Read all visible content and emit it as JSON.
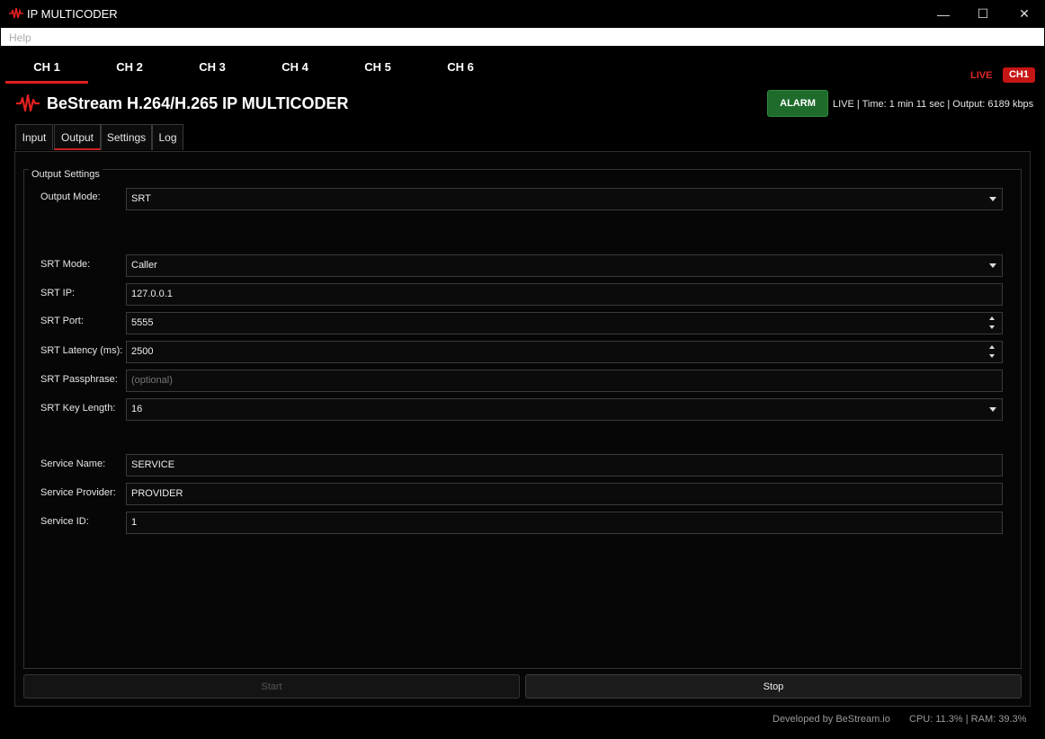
{
  "window": {
    "title": "IP MULTICODER",
    "minimize": "—",
    "maximize": "☐",
    "close": "✕"
  },
  "menu": {
    "help": "Help"
  },
  "channels": [
    "CH 1",
    "CH 2",
    "CH 3",
    "CH 4",
    "CH 5",
    "CH 6"
  ],
  "live_label": "LIVE",
  "channel_badge": "CH1",
  "header": {
    "title": "BeStream H.264/H.265 IP MULTICODER",
    "alarm": "ALARM",
    "status": "LIVE | Time: 1 min 11 sec | Output: 6189 kbps"
  },
  "tabs": [
    "Input",
    "Output",
    "Settings",
    "Log"
  ],
  "output_settings": {
    "group_title": "Output Settings",
    "output_mode": {
      "label": "Output Mode:",
      "value": "SRT"
    },
    "srt_mode": {
      "label": "SRT Mode:",
      "value": "Caller"
    },
    "srt_ip": {
      "label": "SRT IP:",
      "value": "127.0.0.1"
    },
    "srt_port": {
      "label": "SRT Port:",
      "value": "5555"
    },
    "srt_latency": {
      "label": "SRT Latency (ms):",
      "value": "2500"
    },
    "srt_passphrase": {
      "label": "SRT Passphrase:",
      "placeholder": "(optional)"
    },
    "srt_key_length": {
      "label": "SRT Key Length:",
      "value": "16"
    },
    "service_name": {
      "label": "Service Name:",
      "value": "SERVICE"
    },
    "service_provider": {
      "label": "Service Provider:",
      "value": "PROVIDER"
    },
    "service_id": {
      "label": "Service ID:",
      "value": "1"
    }
  },
  "actions": {
    "start": "Start",
    "stop": "Stop"
  },
  "footer": {
    "developed_by": "Developed by BeStream.io",
    "resources": "CPU: 11.3% | RAM: 39.3%"
  },
  "colors": {
    "accent_red": "#e02020",
    "alarm_green": "#1e6b2c",
    "background": "#000000"
  }
}
